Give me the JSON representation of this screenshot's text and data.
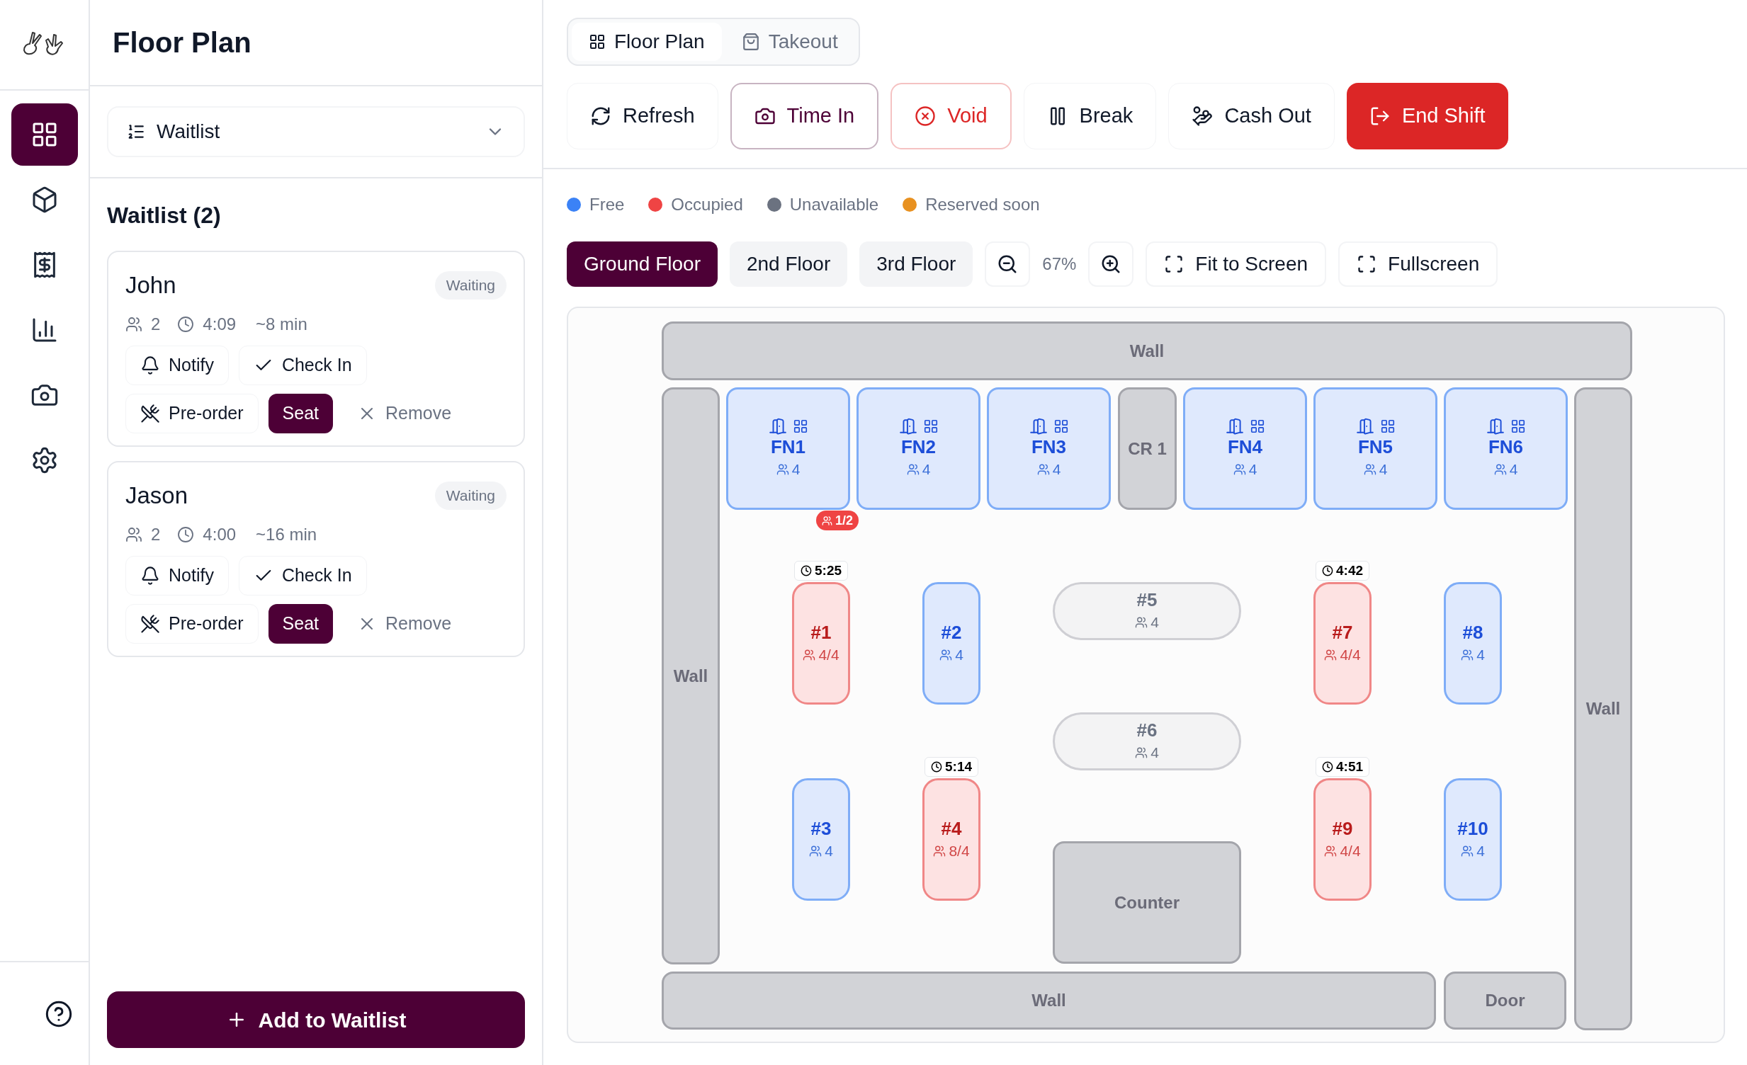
{
  "page_title": "Floor Plan",
  "nav": [
    {
      "selected": true
    },
    {
      "selected": false
    },
    {
      "selected": false
    },
    {
      "selected": false
    },
    {
      "selected": false
    },
    {
      "selected": false
    }
  ],
  "view_select": {
    "value": "Waitlist"
  },
  "waitlist": {
    "title": "Waitlist (2)",
    "entries": [
      {
        "name": "John",
        "status": "Waiting",
        "party": "2",
        "time": "4:09",
        "wait": "~8 min",
        "actions": [
          {
            "label": "Notify",
            "kind": "notify"
          },
          {
            "label": "Check In",
            "kind": "check_in"
          },
          {
            "label": "Pre-order",
            "kind": "preorder"
          },
          {
            "label": "Seat",
            "kind": "seat"
          },
          {
            "label": "Remove",
            "kind": "remove"
          }
        ]
      },
      {
        "name": "Jason",
        "status": "Waiting",
        "party": "2",
        "time": "4:00",
        "wait": "~16 min",
        "actions": [
          {
            "label": "Notify",
            "kind": "notify"
          },
          {
            "label": "Check In",
            "kind": "check_in"
          },
          {
            "label": "Pre-order",
            "kind": "preorder"
          },
          {
            "label": "Seat",
            "kind": "seat"
          },
          {
            "label": "Remove",
            "kind": "remove"
          }
        ]
      }
    ]
  },
  "add_button": "Add to Waitlist",
  "view_tabs": [
    {
      "label": "Floor Plan",
      "selected": true
    },
    {
      "label": "Takeout",
      "selected": false
    }
  ],
  "actions": [
    {
      "label": "Refresh",
      "kind": "refresh"
    },
    {
      "label": "Time In",
      "kind": "time_in"
    },
    {
      "label": "Void",
      "kind": "void"
    },
    {
      "label": "Break",
      "kind": "break"
    },
    {
      "label": "Cash Out",
      "kind": "cash_out"
    },
    {
      "label": "End Shift",
      "kind": "end_shift"
    }
  ],
  "legend": [
    {
      "label": "Free",
      "color": "#3b82f6"
    },
    {
      "label": "Occupied",
      "color": "#ef4444"
    },
    {
      "label": "Unavailable",
      "color": "#6b7280"
    },
    {
      "label": "Reserved soon",
      "color": "#e89120"
    }
  ],
  "floors": [
    {
      "label": "Ground Floor",
      "selected": true
    },
    {
      "label": "2nd Floor",
      "selected": false
    },
    {
      "label": "3rd Floor",
      "selected": false
    }
  ],
  "zoom": {
    "reading": "67%"
  },
  "view_buttons": [
    {
      "label": "Fit to Screen"
    },
    {
      "label": "Fullscreen"
    }
  ],
  "floor_plan": {
    "items": [
      {
        "kind": "zone",
        "label": "Wall"
      },
      {
        "kind": "zone",
        "label": "Wall"
      },
      {
        "kind": "booth",
        "label": "FN1",
        "occupied": false,
        "unavailable": false,
        "seats": "4",
        "guests": "1/2"
      },
      {
        "kind": "booth",
        "label": "FN2",
        "occupied": false,
        "unavailable": false,
        "seats": "4"
      },
      {
        "kind": "booth",
        "label": "FN3",
        "occupied": false,
        "unavailable": false,
        "seats": "4"
      },
      {
        "kind": "zone",
        "label": "CR 1"
      },
      {
        "kind": "booth",
        "label": "FN4",
        "occupied": false,
        "unavailable": false,
        "seats": "4"
      },
      {
        "kind": "booth",
        "label": "FN5",
        "occupied": false,
        "unavailable": false,
        "seats": "4"
      },
      {
        "kind": "booth",
        "label": "FN6",
        "occupied": false,
        "unavailable": false,
        "seats": "4"
      },
      {
        "kind": "zone",
        "label": "Wall"
      },
      {
        "kind": "table",
        "label": "#1",
        "occupied": true,
        "unavailable": false,
        "seats": "4/4",
        "timer": "5:25"
      },
      {
        "kind": "table",
        "label": "#2",
        "occupied": false,
        "unavailable": false,
        "seats": "4"
      },
      {
        "kind": "table",
        "label": "#5",
        "occupied": false,
        "unavailable": true,
        "seats": "4"
      },
      {
        "kind": "table",
        "label": "#7",
        "occupied": true,
        "unavailable": false,
        "seats": "4/4",
        "timer": "4:42"
      },
      {
        "kind": "table",
        "label": "#8",
        "occupied": false,
        "unavailable": false,
        "seats": "4"
      },
      {
        "kind": "table",
        "label": "#6",
        "occupied": false,
        "unavailable": true,
        "seats": "4"
      },
      {
        "kind": "table",
        "label": "#3",
        "occupied": false,
        "unavailable": false,
        "seats": "4"
      },
      {
        "kind": "table",
        "label": "#4",
        "occupied": true,
        "unavailable": false,
        "seats": "8/4",
        "timer": "5:14"
      },
      {
        "kind": "zone",
        "label": "Counter"
      },
      {
        "kind": "table",
        "label": "#9",
        "occupied": true,
        "unavailable": false,
        "seats": "4/4",
        "timer": "4:51"
      },
      {
        "kind": "table",
        "label": "#10",
        "occupied": false,
        "unavailable": false,
        "seats": "4"
      },
      {
        "kind": "zone",
        "label": "Wall"
      },
      {
        "kind": "zone",
        "label": "Door"
      }
    ]
  }
}
